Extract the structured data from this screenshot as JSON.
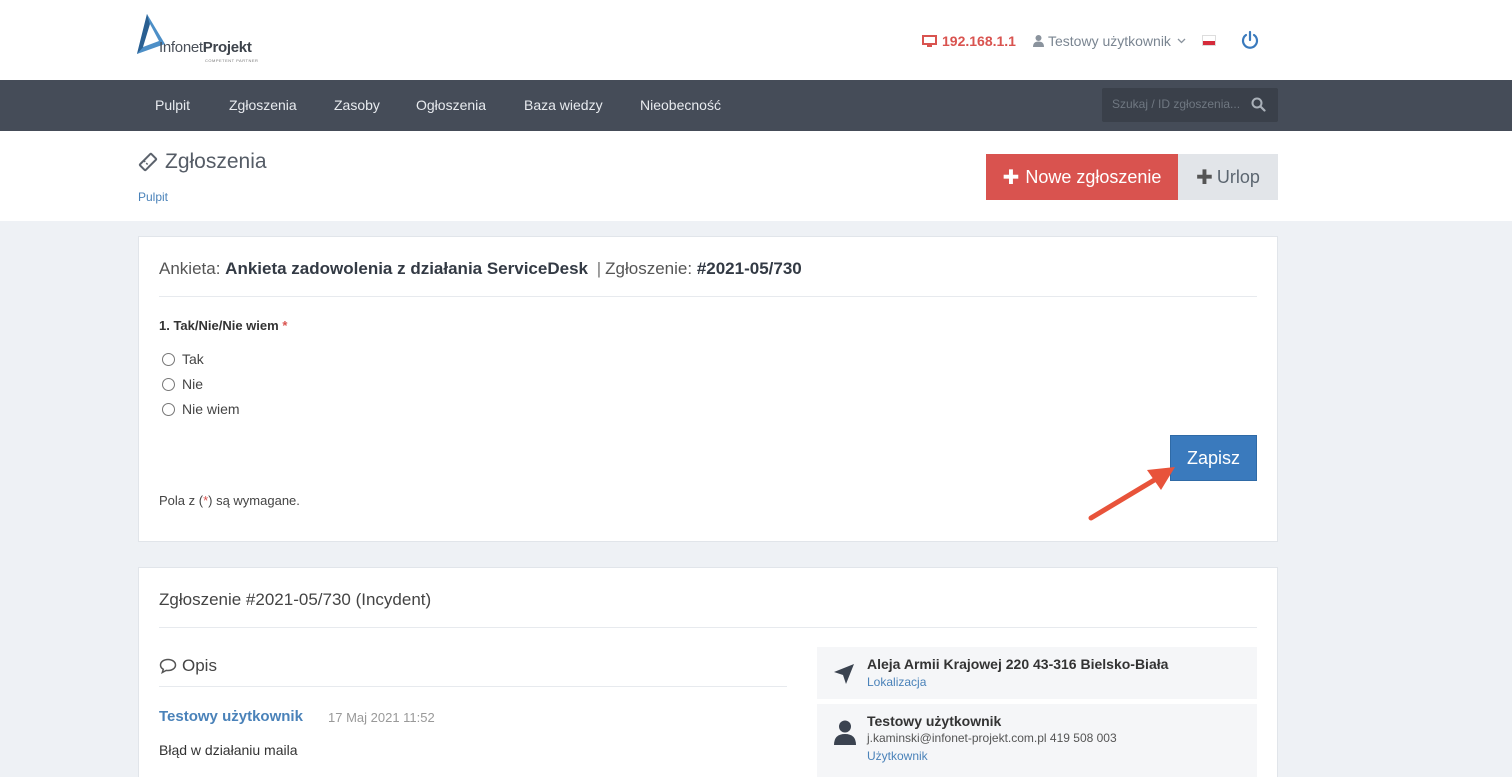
{
  "header": {
    "logo": {
      "brand_light": "Infonet",
      "brand_bold": "Projekt",
      "tagline": "COMPETENT PARTNER"
    },
    "ip": "192.168.1.1",
    "user": "Testowy użytkownik",
    "language_flag": "pl"
  },
  "nav": {
    "items": [
      "Pulpit",
      "Zgłoszenia",
      "Zasoby",
      "Ogłoszenia",
      "Baza wiedzy",
      "Nieobecność"
    ],
    "search_placeholder": "Szukaj / ID zgłoszenia..."
  },
  "page": {
    "title": "Zgłoszenia",
    "breadcrumb": "Pulpit",
    "new_button": "Nowe zgłoszenie",
    "leave_button": "Urlop"
  },
  "survey": {
    "prefix": "Ankieta:",
    "name": "Ankieta zadowolenia z działania ServiceDesk",
    "separator": "|",
    "ticket_prefix": "Zgłoszenie:",
    "ticket_id": "#2021-05/730",
    "question": "1. Tak/Nie/Nie wiem",
    "required_mark": "*",
    "options": [
      "Tak",
      "Nie",
      "Nie wiem"
    ],
    "save_button": "Zapisz",
    "note_before": "Pola z (",
    "note_mark": "*",
    "note_after": ") są wymagane."
  },
  "ticket": {
    "title": "Zgłoszenie #2021-05/730 (Incydent)",
    "section_opis": "Opis",
    "author": "Testowy użytkownik",
    "date": "17 Maj 2021 11:52",
    "message": "Błąd w działaniu maila",
    "location": {
      "value": "Aleja Armii Krajowej 220 43-316 Bielsko-Biała",
      "label": "Lokalizacja"
    },
    "user_info": {
      "name": "Testowy użytkownik",
      "contact": "j.kaminski@infonet-projekt.com.pl 419 508 003",
      "label": "Użytkownik"
    }
  },
  "colors": {
    "accent_red": "#d9534f",
    "primary_blue": "#3a7abd",
    "nav_bg": "#454c58",
    "link_blue": "#4a82b9"
  },
  "icons": {
    "ip": "monitor-icon",
    "user": "user-icon",
    "power": "power-icon",
    "search": "search-icon",
    "title": "ticket-icon",
    "opis": "comment-icon",
    "location": "location-arrow-icon",
    "person": "person-icon"
  }
}
